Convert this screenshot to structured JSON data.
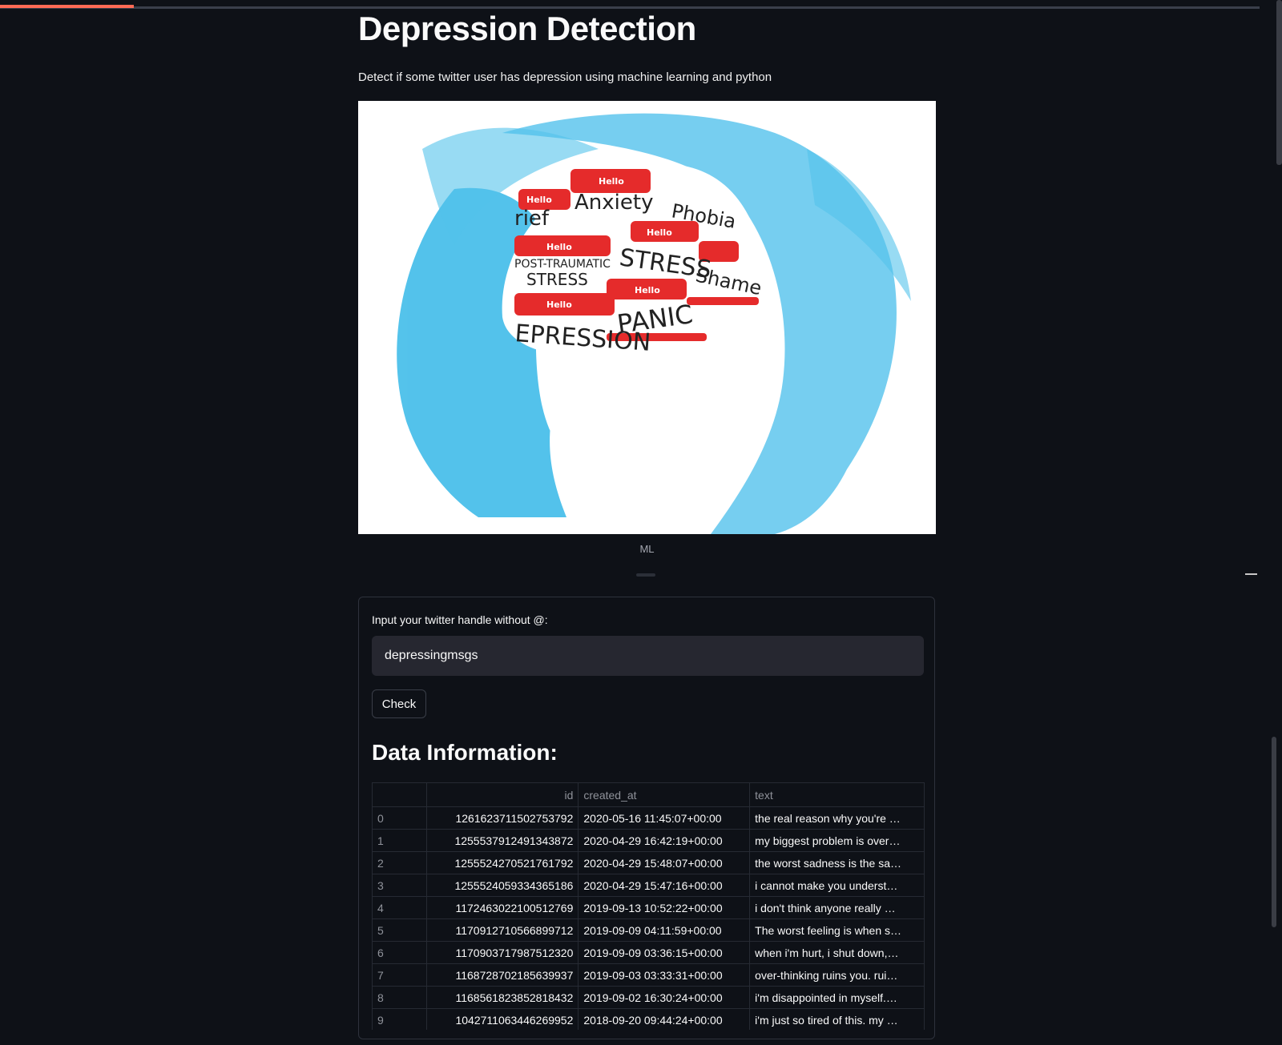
{
  "page": {
    "title": "Depression Detection",
    "subtitle": "Detect if some twitter user has depression using machine learning and python",
    "image_caption": "ML"
  },
  "hero_image": {
    "labels": [
      "Anxiety",
      "Phobia",
      "rief",
      "STRESS",
      "POST-TRAUMATIC",
      "STRESS",
      "Shame",
      "EPRESSION",
      "PANIC",
      "Hello"
    ]
  },
  "form": {
    "handle_label": "Input your twitter handle without @:",
    "handle_value": "depressingmsgs",
    "check_label": "Check"
  },
  "data_section": {
    "heading": "Data Information:",
    "columns": [
      "",
      "id",
      "created_at",
      "text"
    ],
    "rows": [
      {
        "idx": "0",
        "id": "1261623711502753792",
        "created_at": "2020-05-16 11:45:07+00:00",
        "text": "the real reason why you're …"
      },
      {
        "idx": "1",
        "id": "1255537912491343872",
        "created_at": "2020-04-29 16:42:19+00:00",
        "text": "my biggest problem is over…"
      },
      {
        "idx": "2",
        "id": "1255524270521761792",
        "created_at": "2020-04-29 15:48:07+00:00",
        "text": "the worst sadness is the sa…"
      },
      {
        "idx": "3",
        "id": "1255524059334365186",
        "created_at": "2020-04-29 15:47:16+00:00",
        "text": "i cannot make you underst…"
      },
      {
        "idx": "4",
        "id": "1172463022100512769",
        "created_at": "2019-09-13 10:52:22+00:00",
        "text": "i don't think anyone really …"
      },
      {
        "idx": "5",
        "id": "1170912710566899712",
        "created_at": "2019-09-09 04:11:59+00:00",
        "text": "The worst feeling is when s…"
      },
      {
        "idx": "6",
        "id": "1170903717987512320",
        "created_at": "2019-09-09 03:36:15+00:00",
        "text": "when i'm hurt, i shut down,…"
      },
      {
        "idx": "7",
        "id": "1168728702185639937",
        "created_at": "2019-09-03 03:33:31+00:00",
        "text": "over-thinking ruins you. rui…"
      },
      {
        "idx": "8",
        "id": "1168561823852818432",
        "created_at": "2019-09-02 16:30:24+00:00",
        "text": "i'm disappointed in myself.…"
      },
      {
        "idx": "9",
        "id": "1042711063446269952",
        "created_at": "2018-09-20 09:44:24+00:00",
        "text": "i'm just so tired of this. my …"
      }
    ]
  },
  "colors": {
    "background": "#0e1117",
    "accent": "#ff6a55",
    "input_bg": "#262730"
  }
}
